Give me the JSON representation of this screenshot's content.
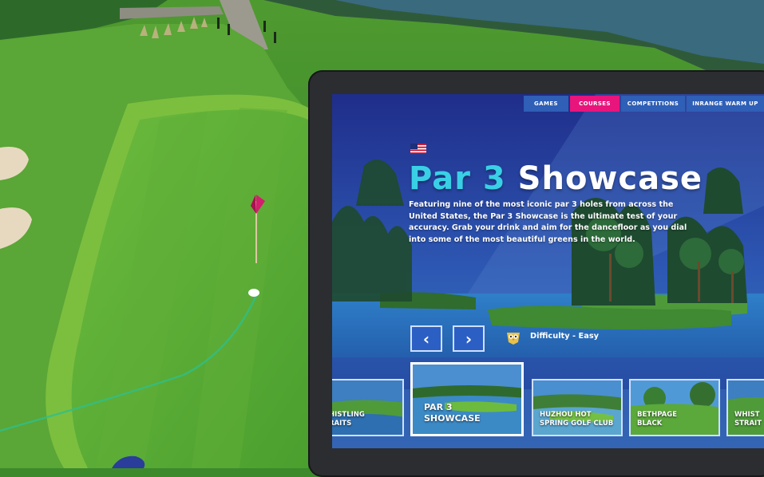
{
  "nav": {
    "games": "Games",
    "courses": "Courses",
    "competitions": "Competitions",
    "range": "Inrange Warm Up"
  },
  "course": {
    "title_part1": "Par 3",
    "title_part2": "Showcase",
    "description": "Featuring nine of the most iconic par 3 holes from across the United States, the Par 3 Showcase is the ultimate test of your accuracy. Grab your drink and aim for the dancefloor as you dial into some of the most beautiful greens in the world.",
    "difficulty": "Difficulty - Easy",
    "flag_icon": "us-flag-icon",
    "difficulty_icon": "owl-badge-icon"
  },
  "arrows": {
    "prev": "‹",
    "next": "›"
  },
  "cards": [
    {
      "line1": "histling",
      "line2": "raits"
    },
    {
      "line1": "Par 3",
      "line2": "Showcase"
    },
    {
      "line1": "Huzhou Hot",
      "line2": "Spring Golf Club"
    },
    {
      "line1": "Bethpage",
      "line2": "Black"
    },
    {
      "line1": "Whist",
      "line2": "Strait"
    }
  ],
  "colors": {
    "accent_pink": "#e8157c",
    "title_cyan": "#39d0e6",
    "button_blue": "#2b5fc4",
    "nav_blue": "#2f5fb6"
  }
}
